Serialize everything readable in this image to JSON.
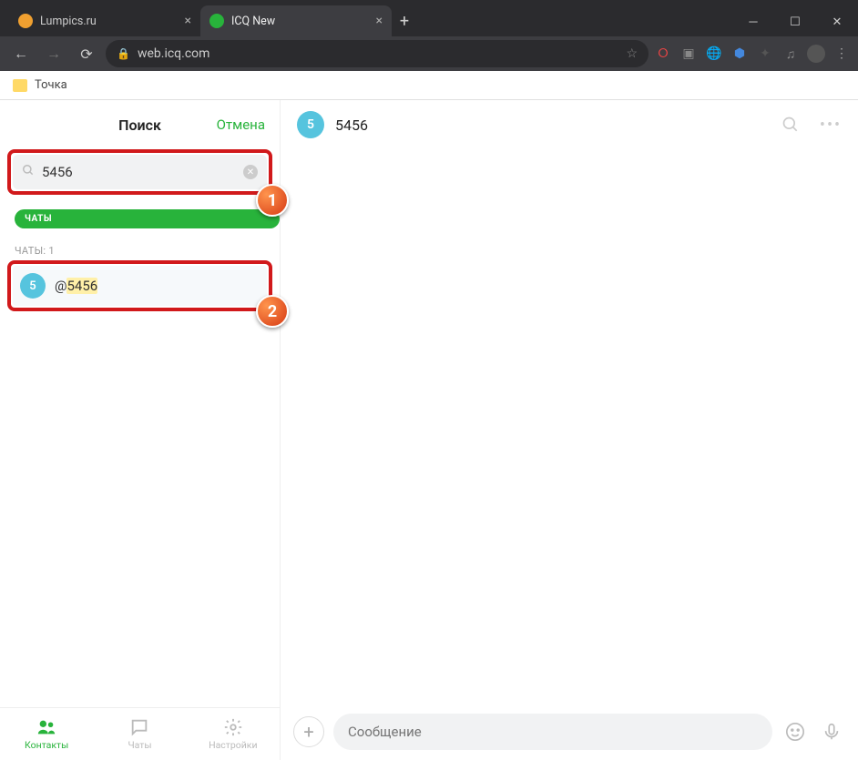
{
  "browser": {
    "tabs": [
      {
        "title": "Lumpics.ru",
        "favicon_color": "#f0a030",
        "active": false
      },
      {
        "title": "ICQ New",
        "favicon_color": "#28b33b",
        "active": true
      }
    ],
    "url": "web.icq.com",
    "bookmark": "Точка"
  },
  "sidebar": {
    "header_title": "Поиск",
    "cancel_label": "Отмена",
    "search_value": "5456",
    "filter_label": "ЧАТЫ",
    "section_label": "ЧАТЫ: 1",
    "result": {
      "avatar_letter": "5",
      "prefix": "@",
      "highlight": "5456"
    },
    "tabs": {
      "contacts": "Контакты",
      "chats": "Чаты",
      "settings": "Настройки"
    }
  },
  "chat": {
    "avatar_letter": "5",
    "title": "5456"
  },
  "composer": {
    "placeholder": "Сообщение"
  },
  "annotations": {
    "b1": "1",
    "b2": "2"
  }
}
